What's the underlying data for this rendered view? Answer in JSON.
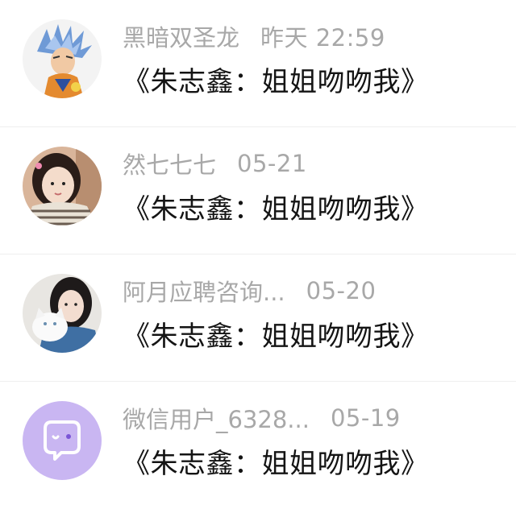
{
  "comments": [
    {
      "username": "黑暗双圣龙",
      "time": "昨天 22:59",
      "message": "《朱志鑫：姐姐吻吻我》",
      "avatar": "anime-character-avatar"
    },
    {
      "username": "然七七七",
      "time": "05-21",
      "message": "《朱志鑫：姐姐吻吻我》",
      "avatar": "girl-photo-avatar"
    },
    {
      "username": "阿月应聘咨询...",
      "time": "05-20",
      "message": "《朱志鑫：姐姐吻吻我》",
      "avatar": "girl-with-cat-avatar"
    },
    {
      "username": "微信用户_6328...",
      "time": "05-19",
      "message": "《朱志鑫：姐姐吻吻我》",
      "avatar": "default-wechat-avatar"
    }
  ],
  "colors": {
    "username": "#a8a8a8",
    "message": "#141414",
    "default_avatar": "#c9b6f2"
  }
}
